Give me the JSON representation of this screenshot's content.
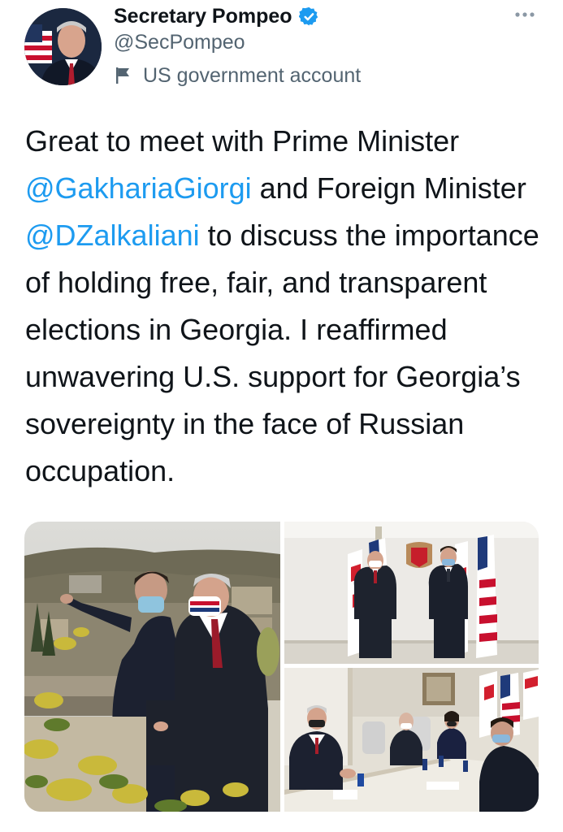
{
  "tweet": {
    "author": {
      "display_name": "Secretary Pompeo",
      "handle": "@SecPompeo",
      "verified": true,
      "verified_icon": "verified-badge-icon",
      "account_label": "US government account",
      "account_label_icon": "flag-icon"
    },
    "more_icon": "more-options-icon",
    "text": [
      {
        "text": "Great to meet with Prime Minister ",
        "type": "text"
      },
      {
        "text": "@GakhariaGiorgi",
        "type": "mention"
      },
      {
        "text": " and Foreign Minister ",
        "type": "text"
      },
      {
        "text": "@DZalkaliani",
        "type": "mention"
      },
      {
        "text": " to discuss the importance of holding free, fair, and transparent elections in Georgia. I reaffirmed unwavering U.S. support for Georgia’s sovereignty in the face of Russian occupation.",
        "type": "text"
      }
    ],
    "media_count": 3
  },
  "colors": {
    "text": "#0f1419",
    "secondary": "#536471",
    "link": "#1d9bf0",
    "verified": "#1d9bf0"
  }
}
